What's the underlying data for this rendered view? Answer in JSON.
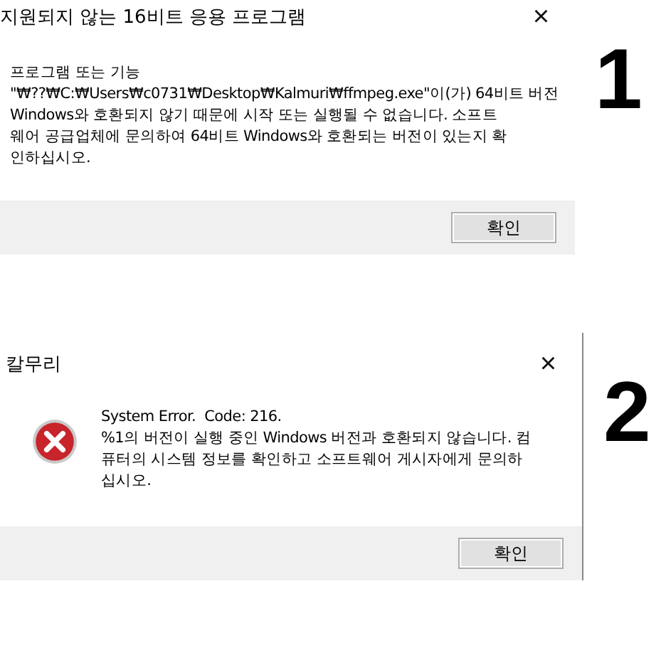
{
  "dialogs": [
    {
      "title": "지원되지 않는 16비트 응용 프로그램",
      "kind": "plain",
      "message_lines": [
        "프로그램 또는 기능",
        "\"₩??₩C:₩Users₩c0731₩Desktop₩Kalmuri₩ffmpeg.exe\"이(가) 64비트 버전",
        "Windows와 호환되지 않기 때문에 시작 또는 실행될 수 없습니다. 소프트",
        "웨어 공급업체에 문의하여 64비트 Windows와 호환되는 버전이 있는지 확",
        "인하십시오."
      ],
      "button": "확인",
      "close": "×",
      "label": "1"
    },
    {
      "title": "칼무리",
      "kind": "error",
      "message_lines": [
        "System Error.  Code: 216.",
        "%1의 버전이 실행 중인 Windows 버전과 호환되지 않습니다. 컴",
        "퓨터의 시스템 정보를 확인하고 소프트웨어 게시자에게 문의하",
        "십시오."
      ],
      "button": "확인",
      "close": "×",
      "label": "2"
    }
  ]
}
